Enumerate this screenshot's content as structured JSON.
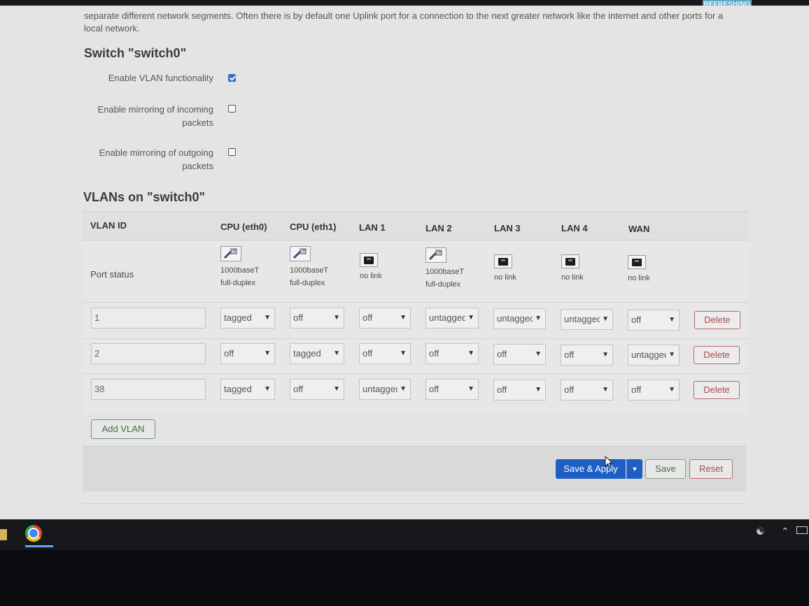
{
  "status_badge": "REFRESHING",
  "description": "separate different network segments. Often there is by default one Uplink port for a connection to the next greater network like the internet and other ports for a local network.",
  "switch_section": {
    "title": "Switch \"switch0\"",
    "options": [
      {
        "label": "Enable VLAN functionality",
        "checked": true
      },
      {
        "label": "Enable mirroring of incoming packets",
        "checked": false
      },
      {
        "label": "Enable mirroring of outgoing packets",
        "checked": false
      }
    ]
  },
  "vlan_section": {
    "title": "VLANs on \"switch0\"",
    "columns": [
      "VLAN ID",
      "CPU (eth0)",
      "CPU (eth1)",
      "LAN 1",
      "LAN 2",
      "LAN 3",
      "LAN 4",
      "WAN"
    ],
    "port_status_label": "Port status",
    "port_status": [
      {
        "link": true,
        "line1": "1000baseT",
        "line2": "full-duplex",
        "icon": "ethernet-connected-icon"
      },
      {
        "link": true,
        "line1": "1000baseT",
        "line2": "full-duplex",
        "icon": "ethernet-connected-icon"
      },
      {
        "link": false,
        "line1": "no link",
        "line2": "",
        "icon": "ethernet-port-icon"
      },
      {
        "link": true,
        "line1": "1000baseT",
        "line2": "full-duplex",
        "icon": "ethernet-connected-icon"
      },
      {
        "link": false,
        "line1": "no link",
        "line2": "",
        "icon": "ethernet-port-icon"
      },
      {
        "link": false,
        "line1": "no link",
        "line2": "",
        "icon": "ethernet-port-icon"
      },
      {
        "link": false,
        "line1": "no link",
        "line2": "",
        "icon": "ethernet-port-icon"
      }
    ],
    "rows": [
      {
        "vlan_id": "1",
        "ports": [
          "tagged",
          "off",
          "off",
          "untagged",
          "untaggec",
          "untaggec",
          "off"
        ],
        "delete_label": "Delete"
      },
      {
        "vlan_id": "2",
        "ports": [
          "off",
          "tagged",
          "off",
          "off",
          "off",
          "off",
          "untaggec"
        ],
        "delete_label": "Delete"
      },
      {
        "vlan_id": "38",
        "ports": [
          "tagged",
          "off",
          "untaggec",
          "off",
          "off",
          "off",
          "off"
        ],
        "delete_label": "Delete"
      }
    ],
    "add_label": "Add VLAN"
  },
  "actions": {
    "save_apply_label": "Save & Apply",
    "save_label": "Save",
    "reset_label": "Reset"
  },
  "colors": {
    "primary": "#1f5fc4",
    "positive": "#3f6f3f",
    "negative": "#a94b4b",
    "badge": "#5fa7c6"
  },
  "taskbar": {
    "apps": [
      "chrome-icon"
    ],
    "tray": [
      "people-icon",
      "chevron-up-icon",
      "battery-icon"
    ]
  }
}
